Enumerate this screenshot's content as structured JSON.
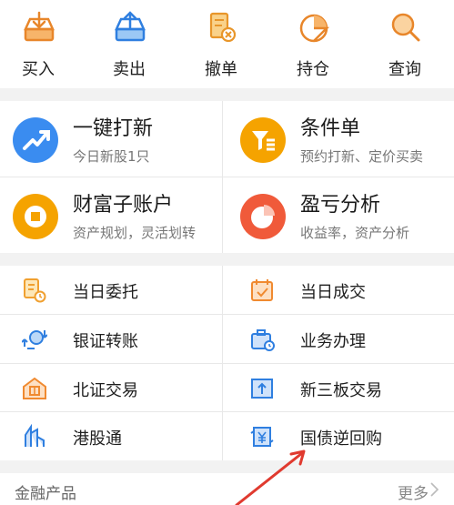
{
  "top_actions": [
    {
      "label": "买入",
      "icon": "buy-tray-icon"
    },
    {
      "label": "卖出",
      "icon": "sell-tray-icon"
    },
    {
      "label": "撤单",
      "icon": "cancel-order-icon"
    },
    {
      "label": "持仓",
      "icon": "position-pie-icon"
    },
    {
      "label": "查询",
      "icon": "search-icon"
    }
  ],
  "features": [
    {
      "title": "一键打新",
      "subtitle": "今日新股1只",
      "icon": "rocket-chart-icon",
      "color": "#3a8cf0"
    },
    {
      "title": "条件单",
      "subtitle": "预约打新、定价买卖",
      "icon": "funnel-list-icon",
      "color": "#f5a300"
    },
    {
      "title": "财富子账户",
      "subtitle": "资产规划，灵活划转",
      "icon": "coin-icon",
      "color": "#f5a300"
    },
    {
      "title": "盈亏分析",
      "subtitle": "收益率，资产分析",
      "icon": "pie-chart-icon",
      "color": "#f05a3a"
    }
  ],
  "grid_items": [
    {
      "label": "当日委托",
      "icon": "daily-order-icon"
    },
    {
      "label": "当日成交",
      "icon": "daily-deal-icon"
    },
    {
      "label": "银证转账",
      "icon": "bank-transfer-icon"
    },
    {
      "label": "业务办理",
      "icon": "business-icon"
    },
    {
      "label": "北证交易",
      "icon": "beijing-exchange-icon"
    },
    {
      "label": "新三板交易",
      "icon": "neeq-trade-icon"
    },
    {
      "label": "港股通",
      "icon": "hk-connect-icon"
    },
    {
      "label": "国债逆回购",
      "icon": "treasury-repo-icon"
    }
  ],
  "section": {
    "title": "金融产品",
    "more": "更多"
  },
  "colors": {
    "orange": "#f09a2a",
    "blue": "#3a8cf0",
    "red": "#e03a2f"
  }
}
